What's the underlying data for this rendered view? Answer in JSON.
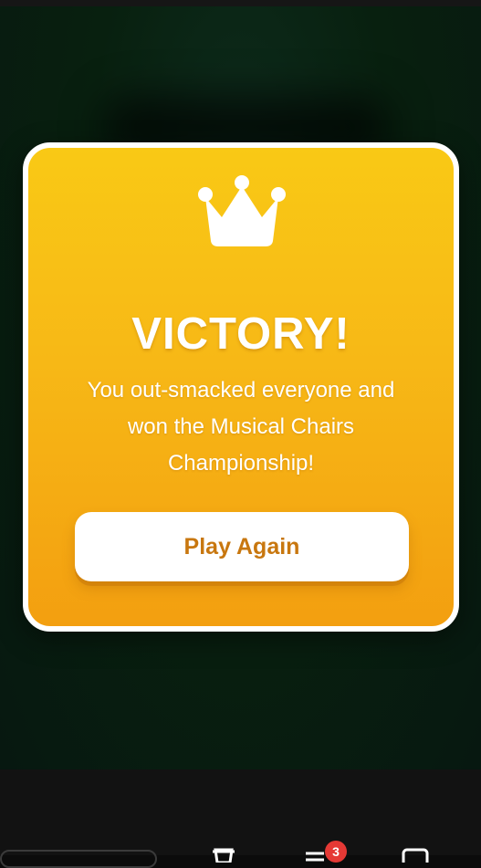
{
  "modal": {
    "title": "VICTORY!",
    "message": "You out-smacked everyone and won the Musical Chairs Championship!",
    "play_again_label": "Play Again",
    "icon": "crown-icon"
  },
  "bottom_nav": {
    "notification_count": "3",
    "icons": [
      "trophy-icon",
      "menu-icon",
      "profile-icon"
    ]
  },
  "colors": {
    "modal_top": "#f9c915",
    "modal_bottom": "#f39f10",
    "button_text": "#c8770f",
    "background": "#08200f",
    "badge": "#e53935"
  }
}
